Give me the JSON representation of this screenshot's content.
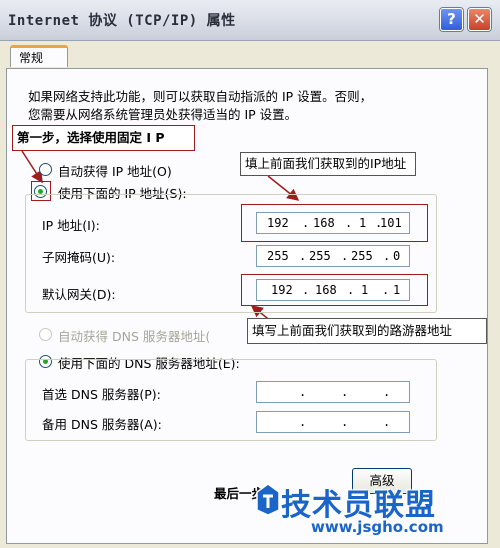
{
  "window": {
    "title": "Internet 协议 (TCP/IP) 属性"
  },
  "titlebar": {
    "help_glyph": "?",
    "close_glyph": "✕"
  },
  "tab": {
    "label": "常规"
  },
  "intro": {
    "line1": "如果网络支持此功能，则可以获取自动指派的 IP 设置。否则，",
    "line2": "您需要从网络系统管理员处获得适当的 IP 设置。"
  },
  "annotations": {
    "step": "第一步，选择使用固定 I P",
    "ip_note": "填上前面我们获取到的IP地址",
    "gateway_note": "填写上前面我们获取到的路游器地址"
  },
  "ip_section": {
    "auto_label": "自动获得 IP 地址(O)",
    "manual_label": "使用下面的 IP 地址(S):",
    "manual_selected": true,
    "fields": [
      {
        "label": "IP 地址(I):",
        "octets": [
          "192",
          "168",
          "1",
          "101"
        ]
      },
      {
        "label": "子网掩码(U):",
        "octets": [
          "255",
          "255",
          "255",
          "0"
        ]
      },
      {
        "label": "默认网关(D):",
        "octets": [
          "192",
          "168",
          "1",
          "1"
        ]
      }
    ]
  },
  "dns_section": {
    "auto_label": "自动获得 DNS 服务器地址(",
    "manual_label": "使用下面的 DNS 服务器地址(E):",
    "manual_selected": true,
    "fields": [
      {
        "label": "首选 DNS 服务器(P):",
        "octets": [
          "",
          "",
          "",
          ""
        ]
      },
      {
        "label": "备用 DNS 服务器(A):",
        "octets": [
          "",
          "",
          "",
          ""
        ]
      }
    ]
  },
  "footer": {
    "last_step_label": "最后一步",
    "advanced_button": "高级"
  },
  "watermark": {
    "brand": "技术员联盟",
    "url": "www.jsgho.com"
  },
  "colors": {
    "annotation_border": "#a01c1c",
    "radio_dot": "#24a824",
    "panel_bg": "#fcfcfe",
    "window_bg": "#ece9d8"
  }
}
